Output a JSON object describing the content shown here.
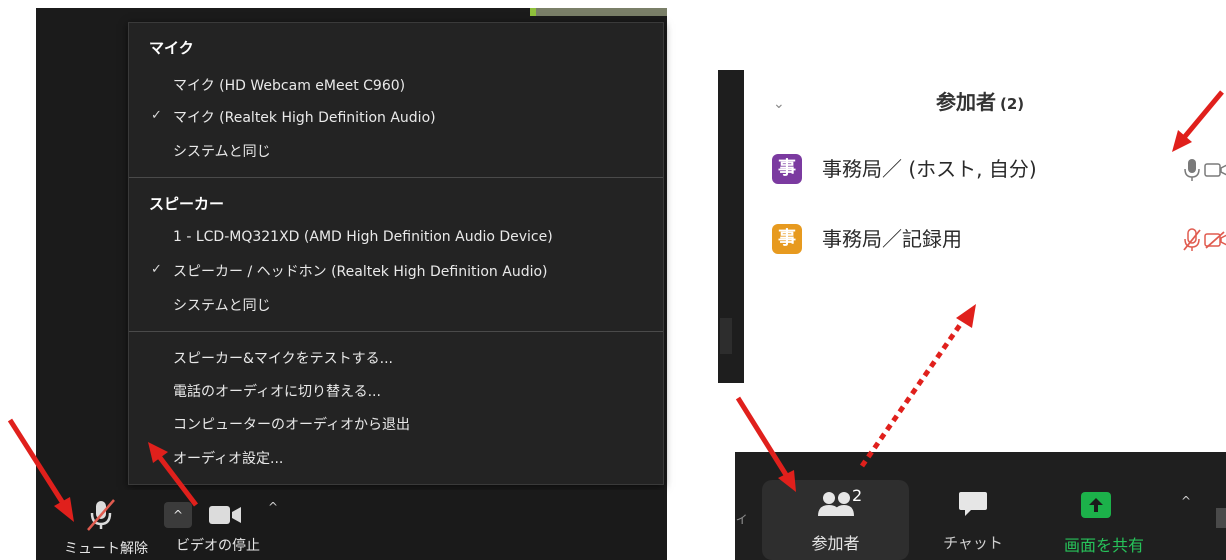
{
  "audio_menu": {
    "mic_heading": "マイク",
    "mic_items": [
      {
        "label": "マイク (HD Webcam eMeet C960)",
        "checked": false
      },
      {
        "label": "マイク (Realtek High Definition Audio)",
        "checked": true
      },
      {
        "label": "システムと同じ",
        "checked": false
      }
    ],
    "speaker_heading": "スピーカー",
    "speaker_items": [
      {
        "label": "1 - LCD-MQ321XD (AMD High Definition Audio Device)",
        "checked": false
      },
      {
        "label": "スピーカー / ヘッドホン (Realtek High Definition Audio)",
        "checked": true
      },
      {
        "label": "システムと同じ",
        "checked": false
      }
    ],
    "check_mark": "✓",
    "actions": [
      "スピーカー&マイクをテストする...",
      "電話のオーディオに切り替える...",
      "コンピューターのオーディオから退出",
      "オーディオ設定..."
    ]
  },
  "left_toolbar": {
    "mute_label": "ミュート解除",
    "video_label": "ビデオの停止",
    "caret": "^"
  },
  "participants_panel": {
    "chevron": "⌄",
    "title": "参加者",
    "count": "(2)",
    "participants": [
      {
        "avatar": "事",
        "avatar_color": "#7b3aa0",
        "name": "事務局／ (ホスト, 自分)",
        "muted": false,
        "video_off": false
      },
      {
        "avatar": "事",
        "avatar_color": "#e79a1f",
        "name": "事務局／記録用",
        "muted": true,
        "video_off": true
      }
    ]
  },
  "right_toolbar": {
    "left_fragment": "ィ",
    "participants_label": "参加者",
    "participants_count": "2",
    "chat_label": "チャット",
    "share_label": "画面を共有",
    "caret": "^"
  },
  "colors": {
    "annotation_red": "#e0201c",
    "share_green": "#1cb14a",
    "muted_red": "#e05b4f"
  }
}
